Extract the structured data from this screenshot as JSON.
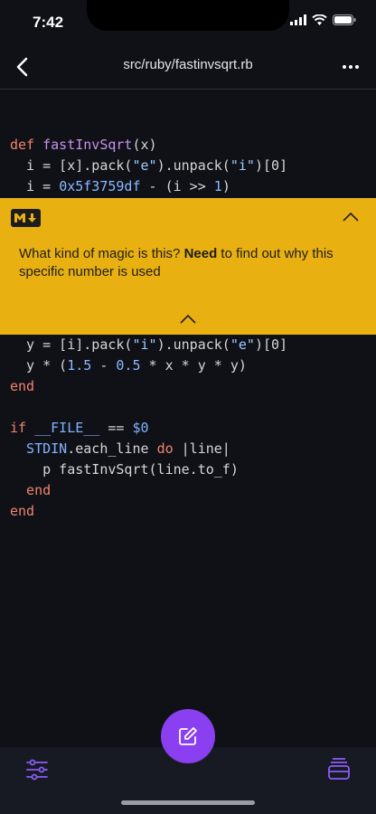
{
  "status_bar": {
    "time": "7:42"
  },
  "nav": {
    "title": "src/ruby/fastinvsqrt.rb"
  },
  "code_top": [
    [
      {
        "t": "def ",
        "c": "kw"
      },
      {
        "t": "fastInvSqrt",
        "c": "fn"
      },
      {
        "t": "(x)",
        "c": ""
      }
    ],
    [
      {
        "t": "  i = [x].pack(",
        "c": ""
      },
      {
        "t": "\"e\"",
        "c": "str"
      },
      {
        "t": ").unpack(",
        "c": ""
      },
      {
        "t": "\"i\"",
        "c": "str"
      },
      {
        "t": ")[0]",
        "c": ""
      }
    ],
    [
      {
        "t": "  i = ",
        "c": ""
      },
      {
        "t": "0x5f3759df",
        "c": "num"
      },
      {
        "t": " - (i >> ",
        "c": ""
      },
      {
        "t": "1",
        "c": "num"
      },
      {
        "t": ")",
        "c": ""
      }
    ]
  ],
  "code_bottom": [
    [
      {
        "t": "  y = [i].pack(",
        "c": ""
      },
      {
        "t": "\"i\"",
        "c": "str"
      },
      {
        "t": ").unpack(",
        "c": ""
      },
      {
        "t": "\"e\"",
        "c": "str"
      },
      {
        "t": ")[0]",
        "c": ""
      }
    ],
    [
      {
        "t": "  y * (",
        "c": ""
      },
      {
        "t": "1.5",
        "c": "num"
      },
      {
        "t": " - ",
        "c": ""
      },
      {
        "t": "0.5",
        "c": "num"
      },
      {
        "t": " * x * y * y)",
        "c": ""
      }
    ],
    [
      {
        "t": "end",
        "c": "kw"
      }
    ],
    [
      {
        "t": "",
        "c": ""
      }
    ],
    [
      {
        "t": "if ",
        "c": "kw"
      },
      {
        "t": "__FILE__",
        "c": "var"
      },
      {
        "t": " == ",
        "c": ""
      },
      {
        "t": "$0",
        "c": "var"
      }
    ],
    [
      {
        "t": "  STDIN",
        "c": "var"
      },
      {
        "t": ".each_line ",
        "c": ""
      },
      {
        "t": "do",
        "c": "kw"
      },
      {
        "t": " |line|",
        "c": ""
      }
    ],
    [
      {
        "t": "    p fastInvSqrt(line.to_f)",
        "c": ""
      }
    ],
    [
      {
        "t": "  end",
        "c": "kw"
      }
    ],
    [
      {
        "t": "end",
        "c": "kw"
      }
    ]
  ],
  "comment": {
    "text_before": "What kind of magic is this? ",
    "text_bold": "Need",
    "text_after": " to find out why this specific number is used"
  },
  "colors": {
    "background": "#0f1117",
    "comment_card": "#e9b012",
    "fab": "#8a3ff0",
    "toolbar_icons": "#8a5cf6"
  },
  "icons": {
    "back": "chevron-left-icon",
    "more": "ellipsis-icon",
    "markdown": "markdown-icon",
    "collapse": "chevron-up-icon",
    "edit": "pencil-square-icon",
    "settings": "sliders-icon",
    "layers": "stack-icon"
  }
}
